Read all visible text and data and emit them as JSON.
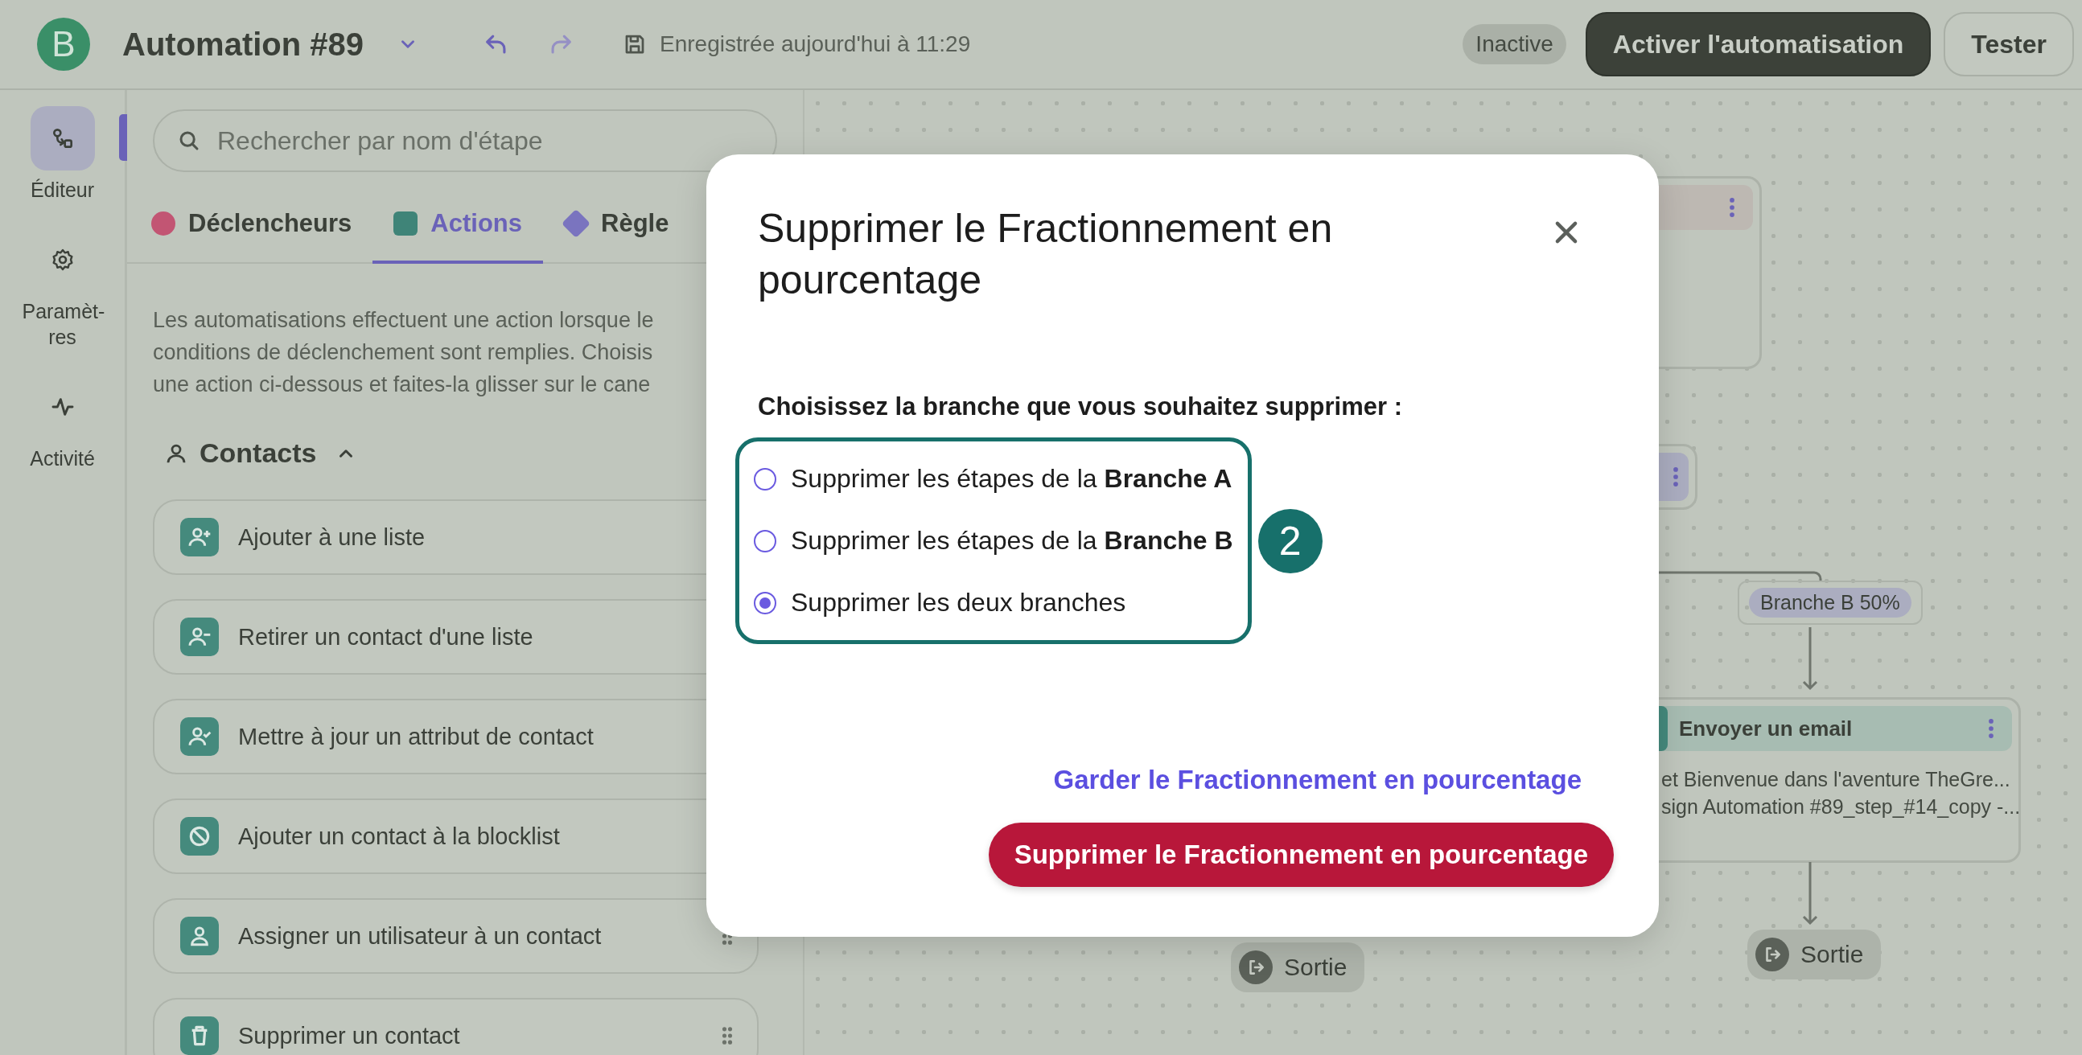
{
  "header": {
    "logo": "B",
    "title": "Automation #89",
    "saved_status": "Enregistrée aujourd'hui à 11:29",
    "status_badge": "Inactive",
    "buttons": [
      {
        "label": "Activer l'automatisation",
        "kind": "primary"
      },
      {
        "label": "Tester",
        "kind": "secondary"
      }
    ]
  },
  "nav_rail": [
    {
      "label": "Éditeur",
      "selected": true
    },
    {
      "label": "Paramèt-res",
      "selected": false
    },
    {
      "label": "Activité",
      "selected": false
    }
  ],
  "panel": {
    "search": {
      "placeholder": "Rechercher par nom d'étape"
    },
    "tabs": [
      {
        "label": "Déclencheurs",
        "selected": false,
        "color": "#c25573"
      },
      {
        "label": "Actions",
        "selected": true,
        "color": "#3f8478"
      },
      {
        "label": "Règle",
        "selected": false,
        "color": "#7a74bf"
      }
    ],
    "description_lines": [
      "Les automatisations effectuent une action lorsque le",
      "conditions de déclenchement sont remplies. Choisis",
      "une action ci-dessous et faites-la glisser sur le cane"
    ],
    "section": {
      "title": "Contacts",
      "expanded": true
    },
    "actions": [
      {
        "label": "Ajouter à une liste"
      },
      {
        "label": "Retirer un contact d'une liste"
      },
      {
        "label": "Mettre à jour un attribut de contact"
      },
      {
        "label": "Ajouter un contact à la blocklist"
      },
      {
        "label": "Assigner un utilisateur à un contact"
      },
      {
        "label": "Supprimer un contact"
      }
    ]
  },
  "canvas": {
    "branch_label": "Branche B 50%",
    "email_node": {
      "title": "Envoyer un email",
      "lines": [
        "et Bienvenue dans l'aventure TheGre...",
        "sign Automation #89_step_#14_copy -..."
      ]
    },
    "exits": [
      "Sortie",
      "Sortie"
    ]
  },
  "modal": {
    "title": "Supprimer le Fractionnement en pourcentage",
    "question": "Choisissez la branche que vous souhaitez supprimer :",
    "options": [
      {
        "label": "Supprimer les étapes de la **Branche A**",
        "selected": false
      },
      {
        "label": "Supprimer les étapes de la **Branche B**",
        "selected": false
      },
      {
        "label": "Supprimer les deux branches",
        "selected": true
      }
    ],
    "step_marker": "2",
    "link": "Garder le Fractionnement en pourcentage",
    "delete_button": "Supprimer le Fractionnement en pourcentage"
  }
}
